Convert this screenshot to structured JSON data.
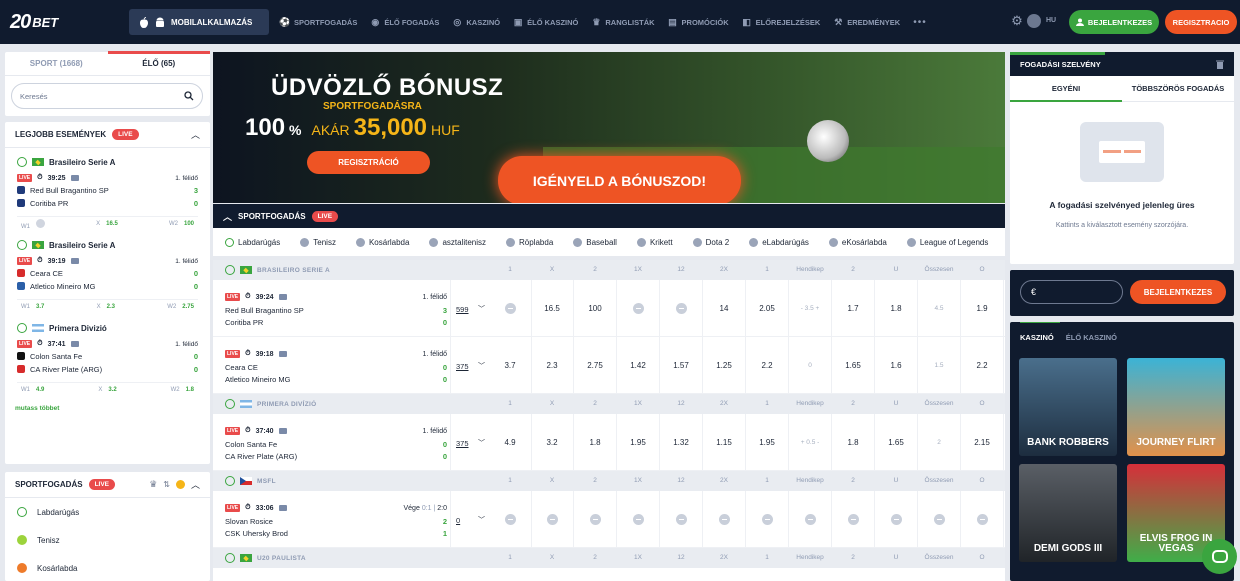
{
  "header": {
    "logo_num": "20",
    "logo_text": "BET",
    "mobile_app": "MOBILALKALMAZÁS",
    "nav": [
      {
        "label": "SPORTFOGADÁS",
        "icon": "soccer-ball-icon"
      },
      {
        "label": "ÉLŐ FOGADÁS",
        "icon": "live-icon"
      },
      {
        "label": "KASZINÓ",
        "icon": "casino-chip-icon"
      },
      {
        "label": "ÉLŐ KASZINÓ",
        "icon": "cards-icon"
      },
      {
        "label": "RANGLISTÁK",
        "icon": "trophy-icon"
      },
      {
        "label": "PROMÓCIÓK",
        "icon": "gift-icon"
      },
      {
        "label": "ELŐREJELZÉSEK",
        "icon": "forecast-icon"
      },
      {
        "label": "EREDMÉNYEK",
        "icon": "results-icon"
      }
    ],
    "more": "•••",
    "lang": "HU",
    "login": "BEJELENTKEZES",
    "register": "REGISZTRACIO"
  },
  "left": {
    "tabs": [
      "SPORT (1668)",
      "ÉLŐ (65)"
    ],
    "search_placeholder": "Keresés",
    "top_events": {
      "title": "LEGJOBB ESEMÉNYEK",
      "live": "LIVE",
      "events": [
        {
          "league": "Brasileiro Serie A",
          "time": "39:25",
          "phase": "1. félidő",
          "home": "Red Bull Bragantino SP",
          "away": "Coritiba PR",
          "hs": "3",
          "as": "0",
          "w1": "",
          "x": "16.5",
          "w2": "100",
          "w1_locked": true
        },
        {
          "league": "Brasileiro Serie A",
          "time": "39:19",
          "phase": "1. félidő",
          "home": "Ceara CE",
          "away": "Atletico Mineiro MG",
          "hs": "0",
          "as": "0",
          "w1": "3.7",
          "x": "2.3",
          "w2": "2.75",
          "w1_locked": false
        },
        {
          "league": "Primera Divizió",
          "time": "37:41",
          "phase": "1. félidő",
          "home": "Colon Santa Fe",
          "away": "CA River Plate (ARG)",
          "hs": "0",
          "as": "0",
          "w1": "4.9",
          "x": "3.2",
          "w2": "1.8",
          "w1_locked": false
        }
      ],
      "labels": {
        "w1": "W1",
        "x": "X",
        "w2": "W2"
      },
      "show_more": "mutass többet"
    },
    "sports": {
      "title": "SPORTFOGADÁS",
      "live": "LIVE",
      "items": [
        "Labdarúgás",
        "Tenisz",
        "Kosárlabda"
      ]
    }
  },
  "banner": {
    "title": "ÜDVÖZLŐ BÓNUSZ",
    "subtitle": "SPORTFOGADÁSRA",
    "percent": "100",
    "percent_sign": "%",
    "upto": "AKÁR",
    "amount": "35,000",
    "currency": "HUF",
    "register": "REGISZTRÁCIÓ",
    "claim": "IGÉNYELD A BÓNUSZOD!"
  },
  "sports_section": {
    "title": "SPORTFOGADÁS",
    "live": "LIVE",
    "filters": [
      "Labdarúgás",
      "Tenisz",
      "Kosárlabda",
      "asztalitenisz",
      "Röplabda",
      "Baseball",
      "Krikett",
      "Dota 2",
      "eLabdarúgás",
      "eKosárlabda",
      "League of Legends"
    ],
    "columns": [
      "1",
      "X",
      "2",
      "1X",
      "12",
      "2X",
      "1",
      "Hendikep",
      "2",
      "U",
      "Összesen",
      "O"
    ]
  },
  "match_groups": [
    {
      "league": "BRASILEIRO SERIE A",
      "flag": "br",
      "matches": [
        {
          "time": "39:24",
          "phase": "1. félidő",
          "phase_extra": "",
          "home": "Red Bull Bragantino SP",
          "away": "Coritiba PR",
          "hs": "3",
          "as": "0",
          "count": "599",
          "odds": [
            "",
            "16.5",
            "100",
            "",
            "",
            "14",
            "2.05",
            "- 3.5 +",
            "1.7",
            "1.8",
            "4.5",
            "1.9"
          ]
        },
        {
          "time": "39:18",
          "phase": "1. félidő",
          "phase_extra": "",
          "home": "Ceara CE",
          "away": "Atletico Mineiro MG",
          "hs": "0",
          "as": "0",
          "count": "375",
          "odds": [
            "3.7",
            "2.3",
            "2.75",
            "1.42",
            "1.57",
            "1.25",
            "2.2",
            "0",
            "1.65",
            "1.6",
            "1.5",
            "2.2"
          ]
        }
      ]
    },
    {
      "league": "PRIMERA DIVÍZIÓ",
      "flag": "ar",
      "matches": [
        {
          "time": "37:40",
          "phase": "1. félidő",
          "phase_extra": "",
          "home": "Colon Santa Fe",
          "away": "CA River Plate (ARG)",
          "hs": "0",
          "as": "0",
          "count": "375",
          "odds": [
            "4.9",
            "3.2",
            "1.8",
            "1.95",
            "1.32",
            "1.15",
            "1.95",
            "+ 0.5 -",
            "1.8",
            "1.65",
            "2",
            "2.15"
          ]
        }
      ]
    },
    {
      "league": "MSFL",
      "flag": "cz",
      "matches": [
        {
          "time": "33:06",
          "phase": "Vége",
          "phase_extra": "0:1 |",
          "phase_score": "2:0",
          "home": "Slovan Rosice",
          "away": "CSK Uhersky Brod",
          "hs": "2",
          "as": "1",
          "count": "0",
          "odds": [
            "",
            "",
            "",
            "",
            "",
            "",
            "",
            "",
            "",
            "",
            "",
            ""
          ]
        }
      ]
    },
    {
      "league": "U20 PAULISTA",
      "flag": "br",
      "matches": []
    }
  ],
  "bet_slip": {
    "title": "FOGADÁSI SZELVÉNY",
    "tabs": [
      "EGYÉNI",
      "TÖBBSZÖRÖS FOGADÁS"
    ],
    "empty": "A fogadási szelvényed jelenleg üres",
    "hint": "Kattints a kiválasztott esemény szorzójára.",
    "currency": "€",
    "login": "BEJELENTKEZES"
  },
  "casino": {
    "tabs": [
      "KASZINÓ",
      "ÉLŐ KASZINÓ"
    ],
    "games": [
      "BANK ROBBERS",
      "JOURNEY FLIRT",
      "DEMI GODS III",
      "ELVIS FROG IN VEGAS"
    ]
  },
  "colors": {
    "brand_green": "#3aa53f",
    "accent_orange": "#ee5424",
    "live_red": "#e94b4b",
    "navy": "#101b2e"
  }
}
